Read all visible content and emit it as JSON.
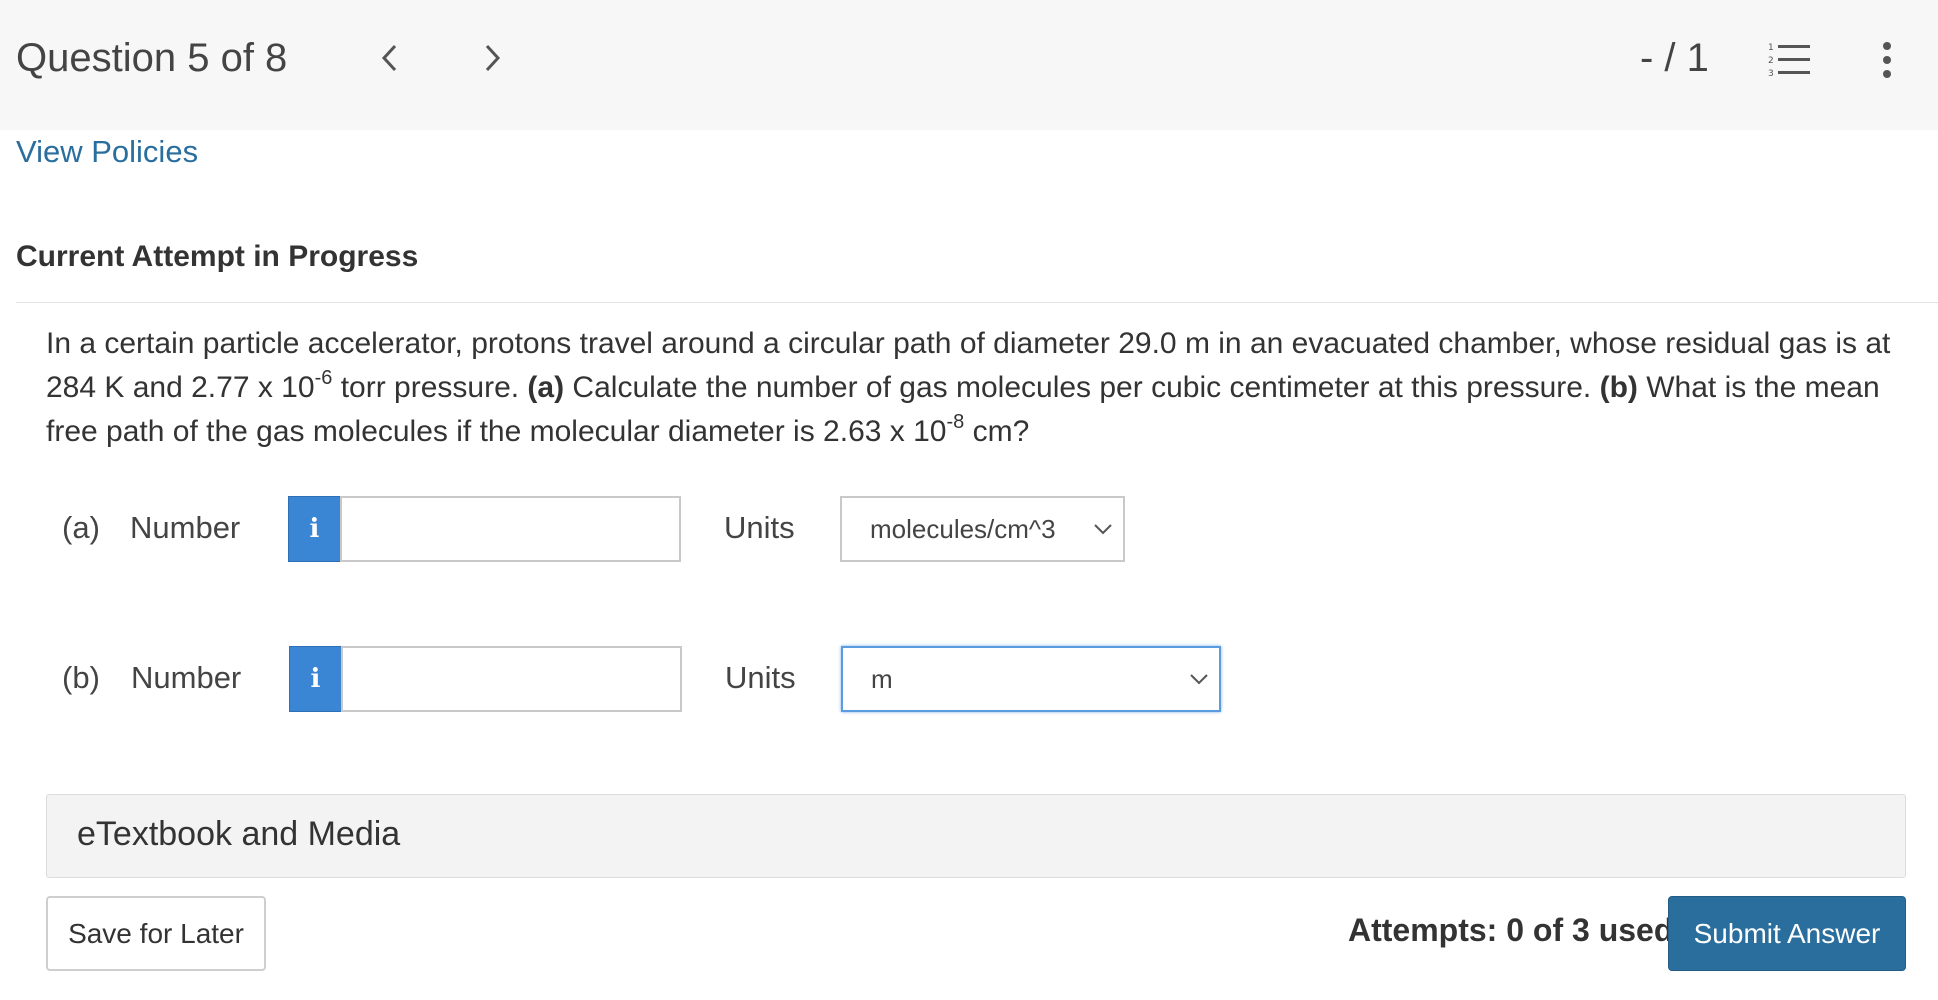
{
  "header": {
    "question_label": "Question 5 of 8",
    "score": "- / 1"
  },
  "links": {
    "view_policies": "View Policies"
  },
  "attempt": {
    "heading": "Current Attempt in Progress"
  },
  "question": {
    "text_1": "In a certain particle accelerator, protons travel around a circular path of diameter 29.0 m in an evacuated chamber, whose residual gas is at 284 K and 2.77 x 10",
    "exp_1": "-6",
    "text_2": " torr pressure. ",
    "part_a_marker": "(a)",
    "text_3": " Calculate the number of gas molecules per cubic centimeter at this pressure. ",
    "part_b_marker": "(b)",
    "text_4": " What is the mean free path of the gas molecules if the molecular diameter is 2.63 x 10",
    "exp_2": "-8",
    "text_5": " cm?"
  },
  "parts": {
    "a": {
      "label": "(a)",
      "number_label": "Number",
      "info_glyph": "i",
      "value": "",
      "units_label": "Units",
      "units_selected": "molecules/cm^3"
    },
    "b": {
      "label": "(b)",
      "number_label": "Number",
      "info_glyph": "i",
      "value": "",
      "units_label": "Units",
      "units_selected": "m"
    }
  },
  "etextbook": {
    "label": "eTextbook and Media"
  },
  "footer": {
    "save_label": "Save for Later",
    "attempts_text": "Attempts: 0 of 3 used",
    "submit_label": "Submit Answer"
  },
  "colors": {
    "primary": "#2a6e9e",
    "info_button": "#3a86d4",
    "header_bg": "#f7f7f7"
  },
  "icons": {
    "prev": "chevron-left-icon",
    "next": "chevron-right-icon",
    "list": "numbered-list-icon",
    "more": "vertical-ellipsis-icon",
    "dropdown": "chevron-down-icon"
  }
}
